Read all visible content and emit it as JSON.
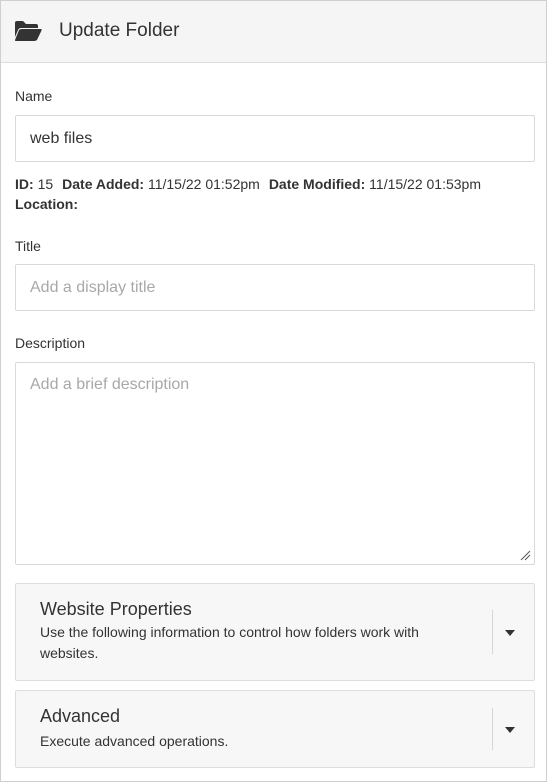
{
  "header": {
    "icon": "folder-open-icon",
    "title": "Update Folder"
  },
  "name_field": {
    "label": "Name",
    "value": "web files"
  },
  "meta": {
    "id_label": "ID:",
    "id_value": "15",
    "date_added_label": "Date Added:",
    "date_added_value": "11/15/22 01:52pm",
    "date_modified_label": "Date Modified:",
    "date_modified_value": "11/15/22 01:53pm",
    "location_label": "Location:"
  },
  "title_field": {
    "label": "Title",
    "placeholder": "Add a display title"
  },
  "description_field": {
    "label": "Description",
    "placeholder": "Add a brief description"
  },
  "sections": [
    {
      "title": "Website Properties",
      "description": "Use the following information to control how folders work with websites.",
      "toggle_icon": "caret-down-icon"
    },
    {
      "title": "Advanced",
      "description": "Execute advanced operations.",
      "toggle_icon": "caret-down-icon"
    }
  ],
  "colors": {
    "header_bg": "#f5f5f5",
    "text": "#333333",
    "placeholder": "#a8a8a8",
    "border": "#d9d9d9",
    "section_bg": "#f7f7f7"
  }
}
